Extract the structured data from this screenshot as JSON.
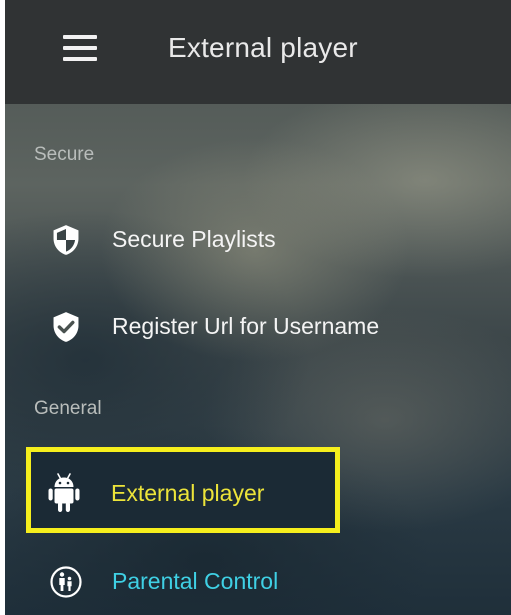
{
  "header": {
    "title": "External player"
  },
  "sections": [
    {
      "label": "Secure",
      "items": [
        {
          "label": "Secure Playlists",
          "icon": "shield-half-icon"
        },
        {
          "label": "Register Url for Username",
          "icon": "shield-check-icon"
        }
      ]
    },
    {
      "label": "General",
      "items": [
        {
          "label": "External player",
          "icon": "android-icon",
          "selected": true
        },
        {
          "label": "Parental Control",
          "icon": "parental-control-icon"
        }
      ]
    }
  ],
  "colors": {
    "topbar": "#303334",
    "highlight": "#f6ef1d",
    "selected_text": "#ece43a",
    "accent_text": "#3fd0e4",
    "text": "#f4f4f4",
    "section_header": "#b9bdbb"
  }
}
